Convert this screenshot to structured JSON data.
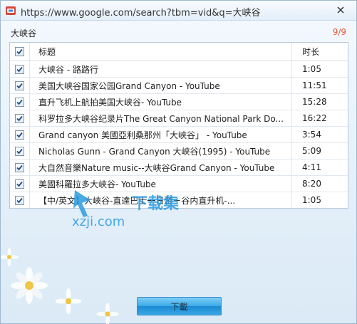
{
  "window": {
    "title": "https://www.google.com/search?tbm=vid&q=大峡谷"
  },
  "header": {
    "keyword": "大峡谷",
    "counter": "9/9"
  },
  "table": {
    "columns": {
      "title": "标题",
      "duration": "时长"
    },
    "rows": [
      {
        "title": "大峡谷 - 路路行",
        "duration": "1:05"
      },
      {
        "title": "美国大峡谷国家公园Grand Canyon - YouTube",
        "duration": "11:51"
      },
      {
        "title": "直升飞机上航拍美国大峡谷- YouTube",
        "duration": "15:28"
      },
      {
        "title": "科罗拉多大峡谷纪录片The Great Canyon National Park Do...",
        "duration": "16:22"
      },
      {
        "title": "Grand canyon 美國亞利桑那州「大峽谷」 - YouTube",
        "duration": "3:54"
      },
      {
        "title": "Nicholas Gunn - Grand Canyon 大峡谷(1995) - YouTube",
        "duration": "5:09"
      },
      {
        "title": "大自然音樂Nature music--大峽谷Grand Canyon - YouTube",
        "duration": "4:11"
      },
      {
        "title": "美國科羅拉多大峽谷- YouTube",
        "duration": "8:20"
      },
      {
        "title": "【中/英文】大峽谷-直達巴士一日游＋谷内直升机-...",
        "duration": "1:05"
      }
    ]
  },
  "footer": {
    "download_label": "下載"
  },
  "watermark": {
    "brand": "下载集",
    "domain": "xzji.com"
  },
  "colors": {
    "accent": "#e35a3b",
    "check": "#1b4f8a",
    "button": "#3aa8e6"
  }
}
